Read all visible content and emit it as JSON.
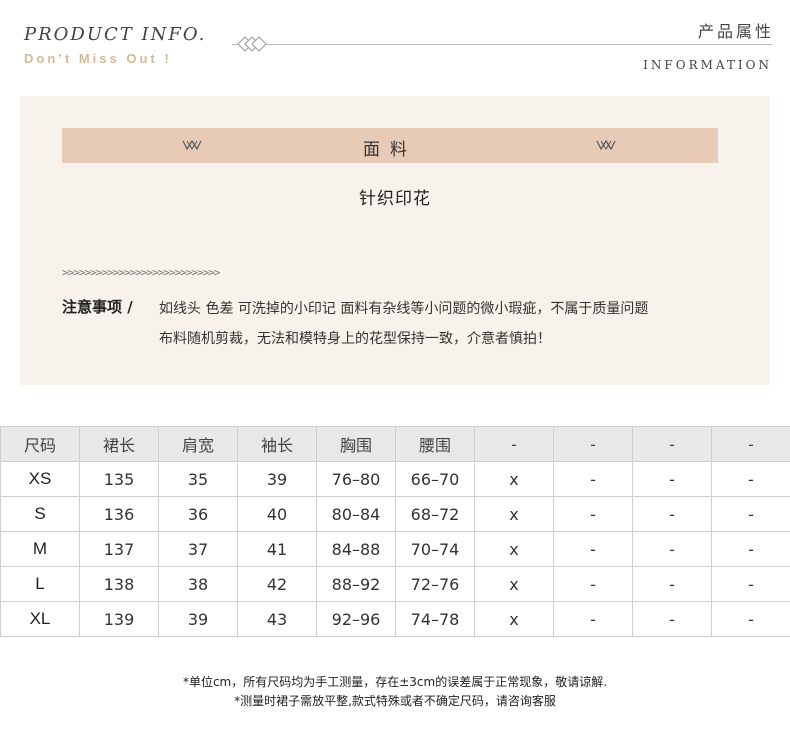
{
  "header": {
    "left_title": "PRODUCT  INFO.",
    "left_subtitle": "Don’t Miss Out !",
    "right_title": "产品属性",
    "right_subtitle": "INFORMATION",
    "accent_color": "#d4b998"
  },
  "fabric": {
    "label": "面料",
    "value": "针织印花",
    "bar_color": "#e8cbb7"
  },
  "notice": {
    "chevrons": ">>>>>>>>>>>>>>>>>>>>>>>>>>>>",
    "label": "注意事项 /",
    "line1": "如线头 色差 可洗掉的小印记 面料有杂线等小问题的微小瑕疵，不属于质量问题",
    "line2": "布料随机剪裁，无法和模特身上的花型保持一致，介意者慎拍！"
  },
  "size_table": {
    "headers": [
      "尺码",
      "裙长",
      "肩宽",
      "袖长",
      "胸围",
      "腰围",
      "-",
      "-",
      "-",
      "-"
    ],
    "rows": [
      [
        "XS",
        "135",
        "35",
        "39",
        "76–80",
        "66–70",
        "x",
        "-",
        "-",
        "-"
      ],
      [
        "S",
        "136",
        "36",
        "40",
        "80–84",
        "68–72",
        "x",
        "-",
        "-",
        "-"
      ],
      [
        "M",
        "137",
        "37",
        "41",
        "84–88",
        "70–74",
        "x",
        "-",
        "-",
        "-"
      ],
      [
        "L",
        "138",
        "38",
        "42",
        "88–92",
        "72–76",
        "x",
        "-",
        "-",
        "-"
      ],
      [
        "XL",
        "139",
        "39",
        "43",
        "92–96",
        "74–78",
        "x",
        "-",
        "-",
        "-"
      ]
    ]
  },
  "notes": {
    "line1": "*单位cm，所有尺码均为手工测量，存在±3cm的误差属于正常现象，敬请谅解.",
    "line2": "*测量时裙子需放平整,款式特殊或者不确定尺码，请咨询客服"
  }
}
